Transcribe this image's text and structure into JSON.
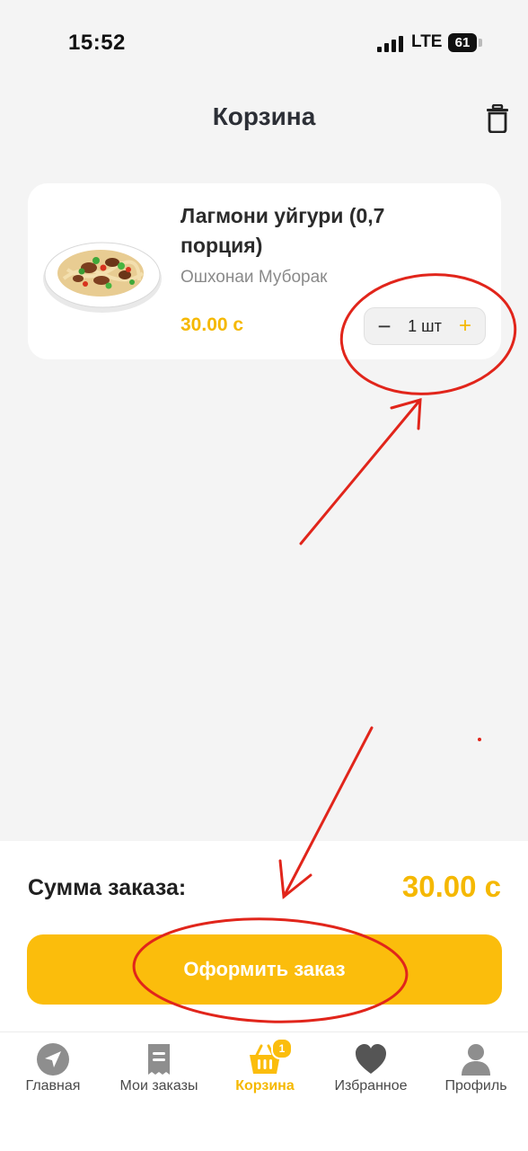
{
  "status_bar": {
    "time": "15:52",
    "network": "LTE",
    "battery": "61"
  },
  "header": {
    "title": "Корзина",
    "delete_icon": "trash-icon"
  },
  "cart": {
    "items": [
      {
        "title": "Лагмони уйгури (0,7 порция)",
        "vendor": "Ошхонаи Муборак",
        "price": "30.00 с",
        "quantity": "1 шт",
        "minus": "−",
        "plus": "+"
      }
    ]
  },
  "summary": {
    "label": "Сумма заказа:",
    "total": "30.00 с"
  },
  "checkout": {
    "label": "Оформить заказ"
  },
  "tabs": [
    {
      "label": "Главная",
      "icon": "navigation-arrow-icon"
    },
    {
      "label": "Мои заказы",
      "icon": "receipt-icon"
    },
    {
      "label": "Корзина",
      "icon": "basket-icon",
      "badge": "1",
      "active": true
    },
    {
      "label": "Избранное",
      "icon": "heart-icon"
    },
    {
      "label": "Профиль",
      "icon": "user-icon"
    }
  ],
  "colors": {
    "accent": "#fbbd0c",
    "price": "#f5b800",
    "annotation": "#e1251b"
  }
}
